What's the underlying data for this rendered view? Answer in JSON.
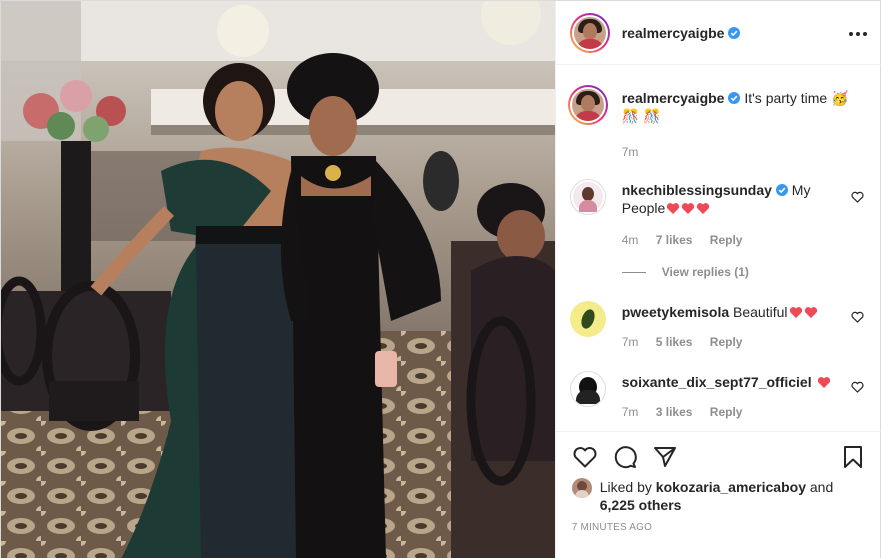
{
  "header": {
    "username": "realmercyaigbe",
    "verified": true
  },
  "caption": {
    "username": "realmercyaigbe",
    "text": "It's party time 🥳",
    "emoji_line": "🎊 🎊",
    "time": "7m"
  },
  "comments": [
    {
      "username": "nkechiblessingsunday",
      "verified": true,
      "text": "My People",
      "hearts": 3,
      "time": "4m",
      "likes": "7 likes",
      "reply": "Reply",
      "view_replies": "View replies (1)"
    },
    {
      "username": "pweetykemisola",
      "verified": false,
      "text": "Beautiful",
      "hearts": 2,
      "time": "7m",
      "likes": "5 likes",
      "reply": "Reply"
    },
    {
      "username": "soixante_dix_sept77_officiel",
      "verified": false,
      "text": "",
      "hearts": 1,
      "time": "7m",
      "likes": "3 likes",
      "reply": "Reply"
    }
  ],
  "actions": {
    "liked_by_prefix": "Liked by",
    "liked_by_user": "kokozaria_americaboy",
    "liked_by_and": "and",
    "liked_by_others": "6,225 others",
    "timestamp": "7 minutes ago"
  },
  "colors": {
    "verified": "#3897f0",
    "heart": "#ed4956",
    "muted": "#8e8e8e",
    "border": "#dbdbdb"
  },
  "icons": [
    "heart-icon",
    "comment-icon",
    "share-icon",
    "bookmark-icon",
    "more-icon",
    "verified-icon"
  ]
}
